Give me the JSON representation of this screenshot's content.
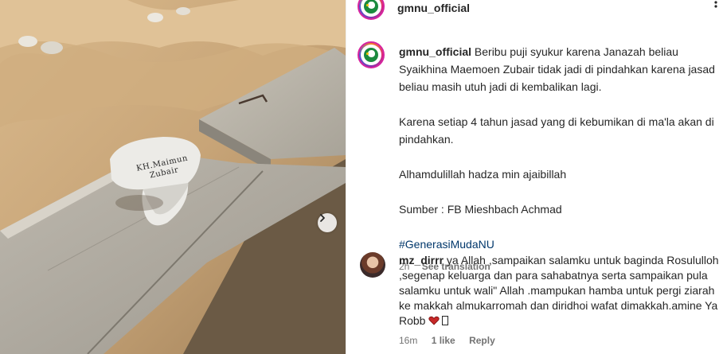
{
  "post": {
    "username": "gmnu_official",
    "more_icon": "more-icon"
  },
  "photo": {
    "stone_text_line1": "KH.Maimun",
    "stone_text_line2": "Zubair",
    "next_icon": "chevron-right-icon"
  },
  "caption": {
    "username": "gmnu_official",
    "line1": "Beribu puji syukur karena Janazah beliau Syaikhina Maemoen Zubair tidak jadi di pindahkan karena jasad beliau masih utuh jadi di kembalikan lagi.",
    "line2": "Karena setiap 4 tahun jasad yang di kebumikan di ma'la akan di pindahkan.",
    "line3": "Alhamdulillah hadza min ajaibillah",
    "line4": "Sumber : FB Mieshbach Achmad",
    "hashtag": "#GenerasiMudaNU",
    "time": "2h",
    "see_translation": "See translation"
  },
  "comment": {
    "username": "mz_dirrr",
    "text": "ya Allah ,sampaikan salamku untuk baginda Rosululloh ,segenap keluarga dan para sahabatnya serta sampaikan pula salamku untuk wali\" Allah .mampukan hamba untuk pergi ziarah ke makkah almukarromah dan diridhoi wafat dimakkah.amine Ya Robb",
    "time": "16m",
    "likes": "1 like",
    "reply": "Reply"
  },
  "colors": {
    "text": "#262626",
    "muted": "#737373",
    "link": "#00376b",
    "logo_green": "#1b8a3e"
  }
}
